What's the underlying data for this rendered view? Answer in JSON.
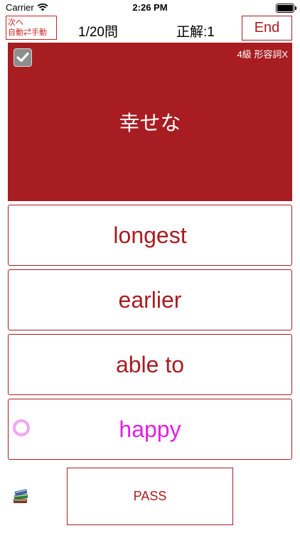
{
  "status_bar": {
    "carrier": "Carrier",
    "time": "2:26 PM"
  },
  "header": {
    "mode_button_line1": "次へ",
    "mode_button_line2": "自動⇄手動",
    "question_count": "1/20問",
    "correct_count": "正解:1",
    "end_label": "End"
  },
  "card": {
    "level": "4級  形容詞X",
    "prompt": "幸せな",
    "checkbox_checked": true,
    "background_color": "#a81d22"
  },
  "choices": [
    {
      "label": "longest",
      "is_correct": false
    },
    {
      "label": "earlier",
      "is_correct": false
    },
    {
      "label": "able to",
      "is_correct": false
    },
    {
      "label": "happy",
      "is_correct": true
    }
  ],
  "footer": {
    "books_icon": "books-icon",
    "pass_label": "PASS"
  },
  "colors": {
    "accent": "#a81d22",
    "correct_text": "#e31ee3",
    "correct_marker": "#f5a3f5",
    "mode_button": "#cc2222"
  }
}
